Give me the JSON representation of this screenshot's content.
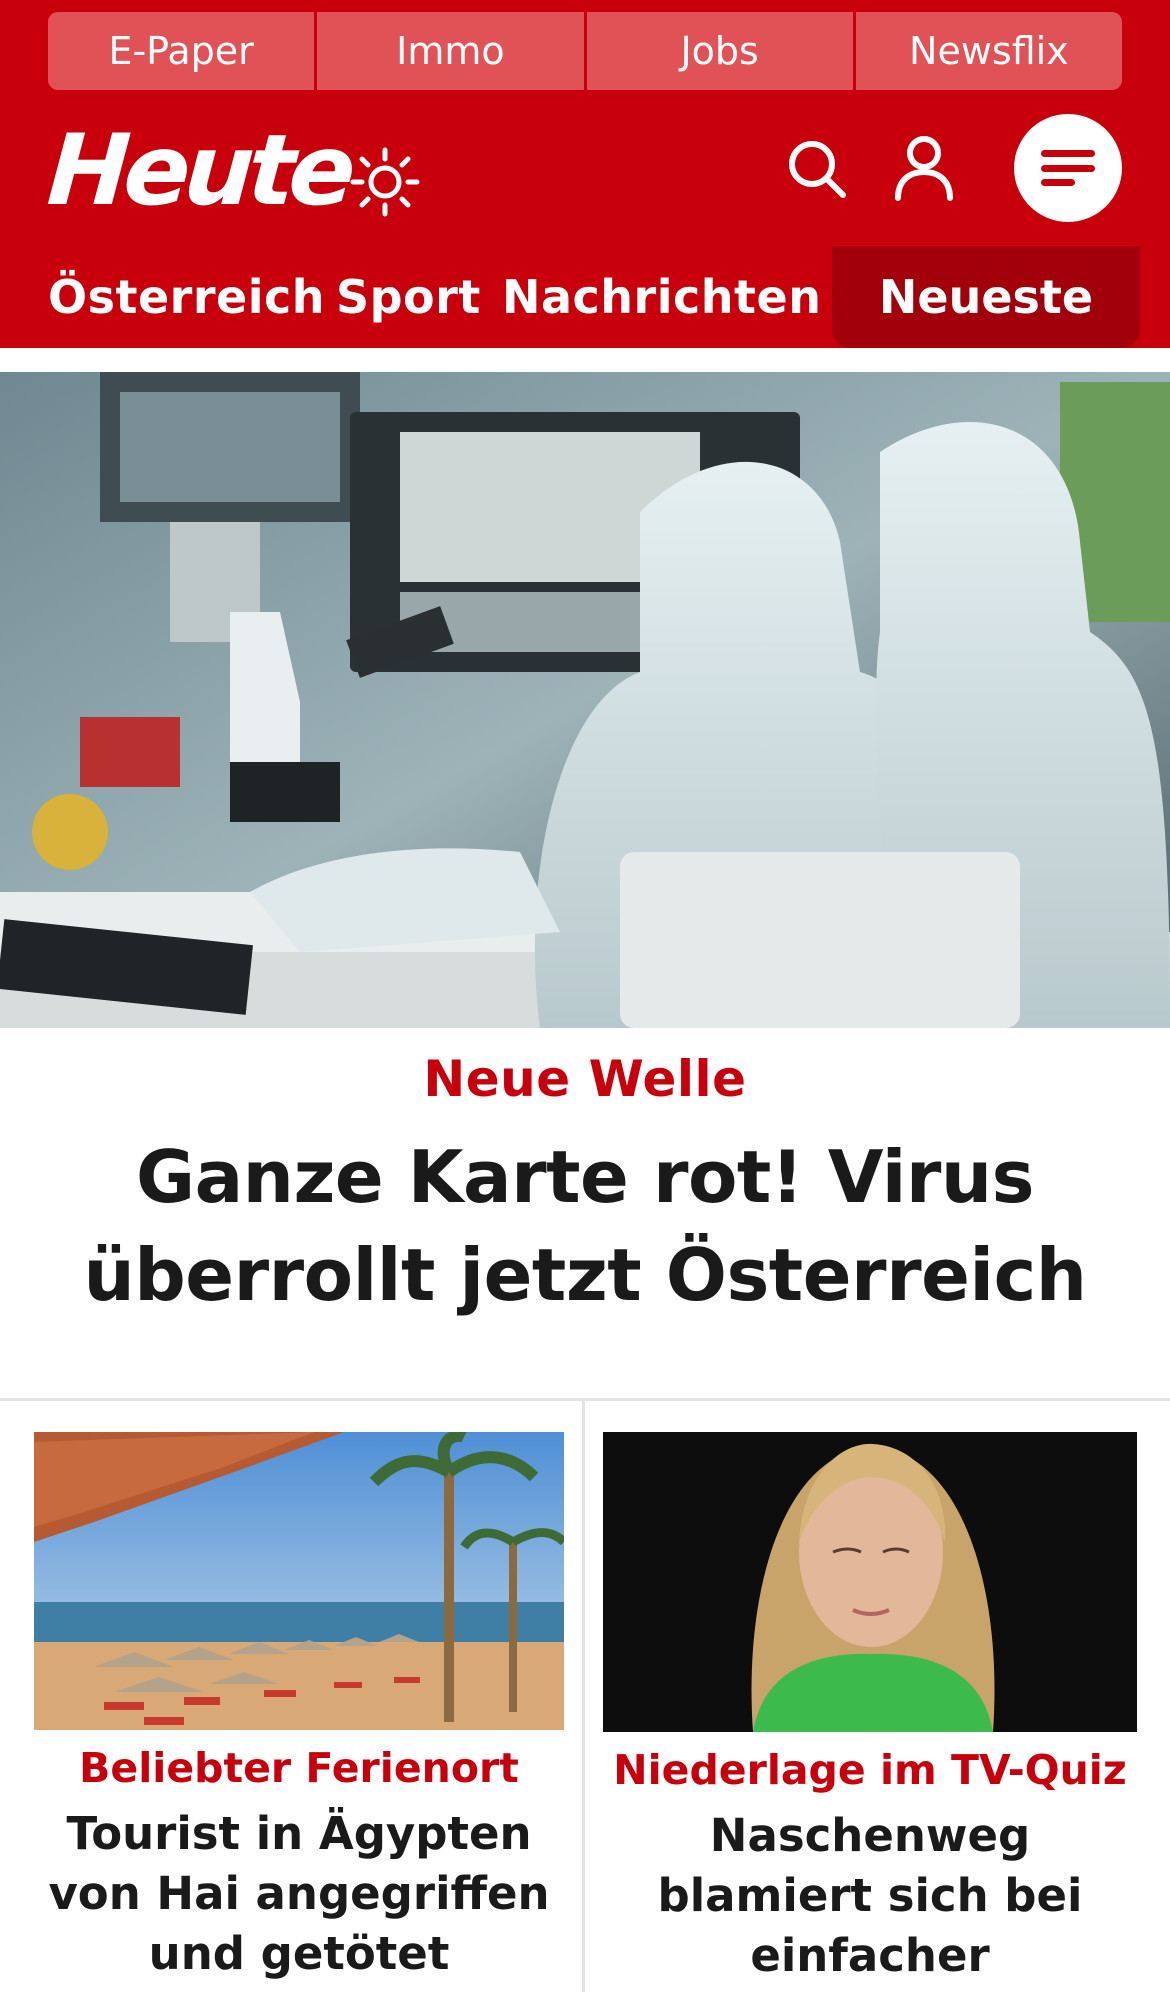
{
  "top_links": [
    "E-Paper",
    "Immo",
    "Jobs",
    "Newsflix"
  ],
  "brand": {
    "logo_text": "Heute"
  },
  "nav": {
    "items": [
      "Österreich",
      "Sport",
      "Nachrichten"
    ],
    "highlight": "Neueste"
  },
  "colors": {
    "brand_red": "#c8000b",
    "dark_red": "#a2000a",
    "top_link_bg": "#e15257",
    "text": "#1a1a1a"
  },
  "icons": {
    "weather": "sun-icon",
    "search": "search-icon",
    "account": "user-icon",
    "menu": "hamburger-icon"
  },
  "hero": {
    "kicker": "Neue Welle",
    "title": "Ganze Karte rot! Virus überrollt jetzt Österreich"
  },
  "teasers": [
    {
      "kicker": "Beliebter Ferienort",
      "title": "Tourist in Ägypten von Hai angegriffen und getötet"
    },
    {
      "kicker": "Niederlage im TV-Quiz",
      "title": "Naschenweg blamiert sich bei einfacher Hauptstadt-Frage"
    }
  ]
}
